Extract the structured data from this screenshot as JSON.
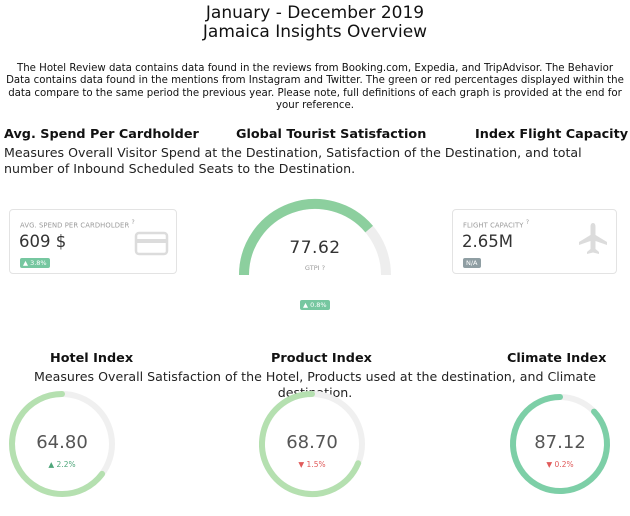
{
  "header": {
    "title_line1": "January - December 2019",
    "title_line2": "Jamaica Insights Overview"
  },
  "intro": "The Hotel Review data contains data found in the reviews from Booking.com, Expedia, and TripAdvisor. The Behavior Data contains data found in the mentions from Instagram and Twitter. The green or red percentages displayed within the data compare to the same period the previous year. Please note, full definitions of each graph is provided at the end for your reference.",
  "kpis": {
    "heading_spend": "Avg. Spend Per Cardholder",
    "heading_satisfaction": "Global Tourist Satisfaction",
    "heading_flight": "Index Flight Capacity",
    "description": "Measures Overall Visitor Spend at the Destination, Satisfaction of the Destination, and total number of Inbound Scheduled Seats to the Destination.",
    "spend_card": {
      "label": "AVG. SPEND PER CARDHOLDER",
      "info": "?",
      "value": "609 $",
      "change": "▲ 3.8%",
      "icon": "credit-card-icon"
    },
    "satisfaction_gauge": {
      "value": "77.62",
      "sub": "GTPI",
      "info": "?",
      "change": "▲ 0.8%",
      "fill": 0.7762,
      "color": "#8ccf9e",
      "track": "#eeeeee"
    },
    "flight_card": {
      "label": "FLIGHT CAPACITY",
      "info": "?",
      "value": "2.65M",
      "change": "N/A",
      "icon": "airplane-icon"
    }
  },
  "indexes": {
    "heading_hotel": "Hotel Index",
    "heading_product": "Product Index",
    "heading_climate": "Climate Index",
    "description": "Measures Overall Satisfaction of the Hotel, Products used at the destination, and Climate destination.",
    "hotel": {
      "value": "64.80",
      "change": "▲ 2.2%",
      "direction": "up",
      "fill": 0.648,
      "color": "#b5e0b0"
    },
    "product": {
      "value": "68.70",
      "change": "▼ 1.5%",
      "direction": "down",
      "fill": 0.687,
      "color": "#b5e0b0"
    },
    "climate": {
      "value": "87.12",
      "change": "▼ 0.2%",
      "direction": "down",
      "fill": 0.8712,
      "color": "#7dcfa7"
    }
  }
}
